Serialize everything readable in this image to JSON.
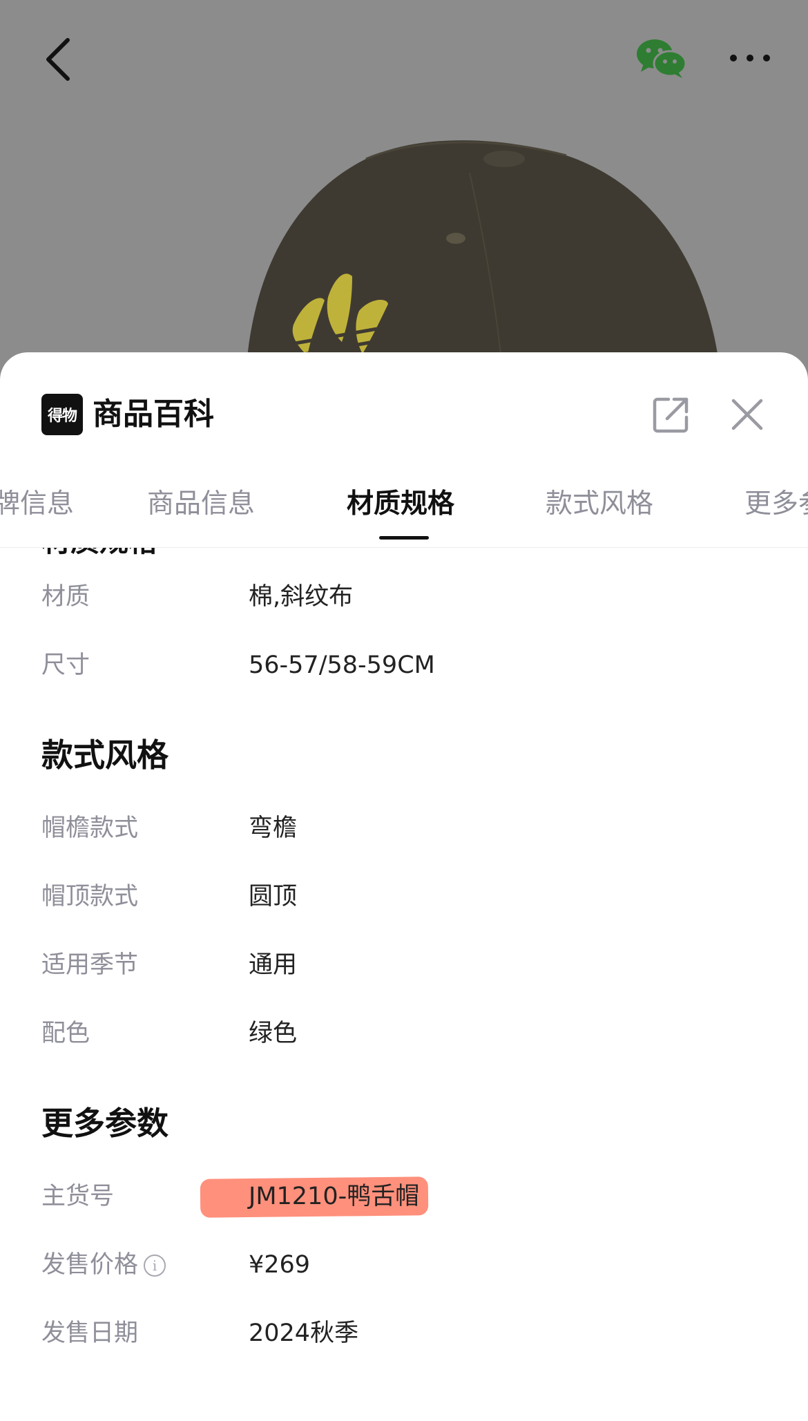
{
  "sheet": {
    "brand_logo_text": "得物",
    "title": "商品百科"
  },
  "tabs": [
    {
      "label": "牌信息"
    },
    {
      "label": "商品信息"
    },
    {
      "label": "材质规格"
    },
    {
      "label": "款式风格"
    },
    {
      "label": "更多参"
    }
  ],
  "active_tab": "材质规格",
  "material_section": {
    "rows": [
      {
        "label": "材质",
        "value": "棉,斜纹布"
      },
      {
        "label": "尺寸",
        "value": "56-57/58-59CM"
      }
    ]
  },
  "style_section": {
    "title": "款式风格",
    "rows": [
      {
        "label": "帽檐款式",
        "value": "弯檐"
      },
      {
        "label": "帽顶款式",
        "value": "圆顶"
      },
      {
        "label": "适用季节",
        "value": "通用"
      },
      {
        "label": "配色",
        "value": "绿色"
      }
    ]
  },
  "more_section": {
    "title": "更多参数",
    "rows": [
      {
        "label": "主货号",
        "value": "JM1210-鸭舌帽"
      },
      {
        "label": "发售价格",
        "value": "¥269"
      },
      {
        "label": "发售日期",
        "value": "2024秋季"
      }
    ]
  },
  "colors": {
    "accent_highlight": "#ff8a75",
    "wechat_green": "#2e7d32",
    "label_gray": "#8f8f9a"
  },
  "icons": [
    "back-arrow-icon",
    "wechat-icon",
    "more-dots-icon",
    "share-external-icon",
    "close-icon",
    "info-icon"
  ]
}
